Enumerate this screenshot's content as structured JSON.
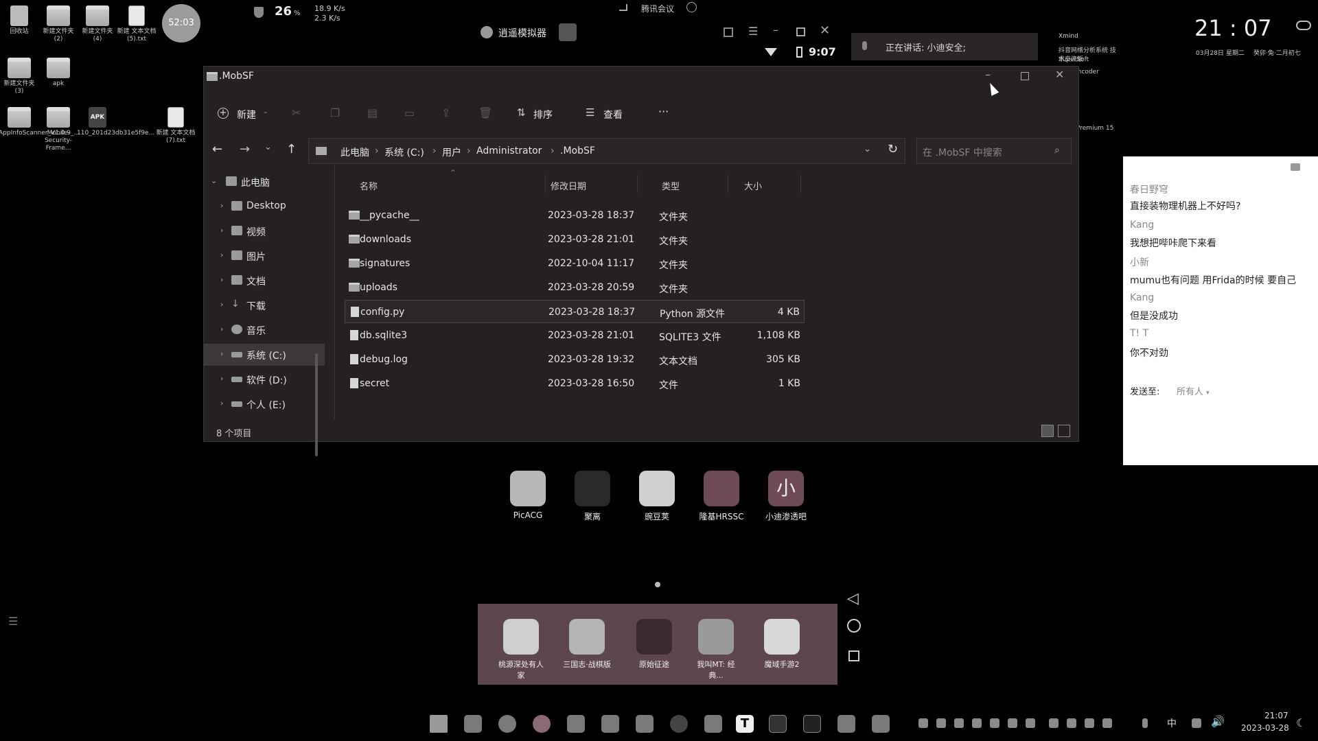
{
  "desktop_icons": [
    {
      "label": "回收站"
    },
    {
      "label": "新建文件夹 (2)"
    },
    {
      "label": "新建文件夹 (4)"
    },
    {
      "label": "新建 文本文档 (5).txt"
    },
    {
      "label": "新建文件夹 (3)"
    },
    {
      "label": "apk"
    },
    {
      "label": "AppInfoScanner_V1.0.9_..."
    },
    {
      "label": "Mobile-Security-Frame..."
    },
    {
      "label": "110_201d23db31e5f9e..."
    },
    {
      "label": "新建 文本文档 (7).txt"
    }
  ],
  "timer": "52:03",
  "sysmon": {
    "cpu": "26",
    "cpu_unit": "%",
    "up": "18.9 K/s",
    "down": "2.3 K/s"
  },
  "meeting": {
    "app_label": "腾讯会议",
    "speaking": "正在讲话: 小迪安全;"
  },
  "emulator_title": "逍遥模拟器",
  "android_status": {
    "time": "9:07"
  },
  "clock": {
    "time": "21 : 07",
    "date": "03月28日",
    "weekday": "星期二",
    "lunar": "癸卯·兔·二月初七"
  },
  "right_panel_items": [
    "Xmind",
    "抖音网络分析系统 技术交流版",
    "SuperSoft",
    "Encoder",
    "Premium 15"
  ],
  "explorer": {
    "title": ".MobSF",
    "toolbar": {
      "new": "新建",
      "sort": "排序",
      "view": "查看",
      "more": "···"
    },
    "breadcrumb": [
      "此电脑",
      "系统 (C:)",
      "用户",
      "Administrator",
      ".MobSF"
    ],
    "search_placeholder": "在 .MobSF 中搜索",
    "nav": [
      {
        "label": "此电脑"
      },
      {
        "label": "Desktop"
      },
      {
        "label": "视频"
      },
      {
        "label": "图片"
      },
      {
        "label": "文档"
      },
      {
        "label": "下载"
      },
      {
        "label": "音乐"
      },
      {
        "label": "系统 (C:)"
      },
      {
        "label": "软件 (D:)"
      },
      {
        "label": "个人 (E:)"
      }
    ],
    "columns": {
      "name": "名称",
      "date": "修改日期",
      "type": "类型",
      "size": "大小"
    },
    "files": [
      {
        "name": "__pycache__",
        "date": "2023-03-28 18:37",
        "type": "文件夹",
        "size": ""
      },
      {
        "name": "downloads",
        "date": "2023-03-28 21:01",
        "type": "文件夹",
        "size": ""
      },
      {
        "name": "signatures",
        "date": "2022-10-04 11:17",
        "type": "文件夹",
        "size": ""
      },
      {
        "name": "uploads",
        "date": "2023-03-28 20:59",
        "type": "文件夹",
        "size": ""
      },
      {
        "name": "config.py",
        "date": "2023-03-28 18:37",
        "type": "Python 源文件",
        "size": "4 KB"
      },
      {
        "name": "db.sqlite3",
        "date": "2023-03-28 21:01",
        "type": "SQLITE3 文件",
        "size": "1,108 KB"
      },
      {
        "name": "debug.log",
        "date": "2023-03-28 19:32",
        "type": "文本文档",
        "size": "305 KB"
      },
      {
        "name": "secret",
        "date": "2023-03-28 16:50",
        "type": "文件",
        "size": "1 KB"
      }
    ],
    "status": "8 个项目"
  },
  "chat": {
    "messages": [
      {
        "name": "春日野穹",
        "text": "直接装物理机器上不好吗?"
      },
      {
        "name": "Kang",
        "text": "我想把哔咔爬下来看"
      },
      {
        "name": "小新",
        "text": "mumu也有问题  用Frida的时候 要自己"
      },
      {
        "name": "Kang",
        "text": "但是没成功"
      },
      {
        "name": "T!  T",
        "text": "你不对劲"
      }
    ],
    "send_to_label": "发送至:",
    "send_to_value": "所有人"
  },
  "home_apps": [
    {
      "label": "PicACG",
      "color": "#b8b8b8"
    },
    {
      "label": "聚离",
      "color": "#2a2a2a"
    },
    {
      "label": "豌豆荚",
      "color": "#cfcfcf"
    },
    {
      "label": "隆基HRSSC",
      "color": "#6e4a58"
    },
    {
      "label": "小迪渗透吧",
      "color": "#6e4a58"
    }
  ],
  "dock_apps": [
    {
      "label": "桃源深处有人家",
      "color": "#cfcfcf"
    },
    {
      "label": "三国志·战棋版",
      "color": "#b5b5b5"
    },
    {
      "label": "原始征途",
      "color": "#3a2a30"
    },
    {
      "label": "我叫MT: 经典...",
      "color": "#9a9a9a"
    },
    {
      "label": "魔域手游2",
      "color": "#d8d8d8"
    }
  ],
  "taskbar": {
    "time": "21:07",
    "date": "2023-03-28",
    "ime": "中"
  }
}
